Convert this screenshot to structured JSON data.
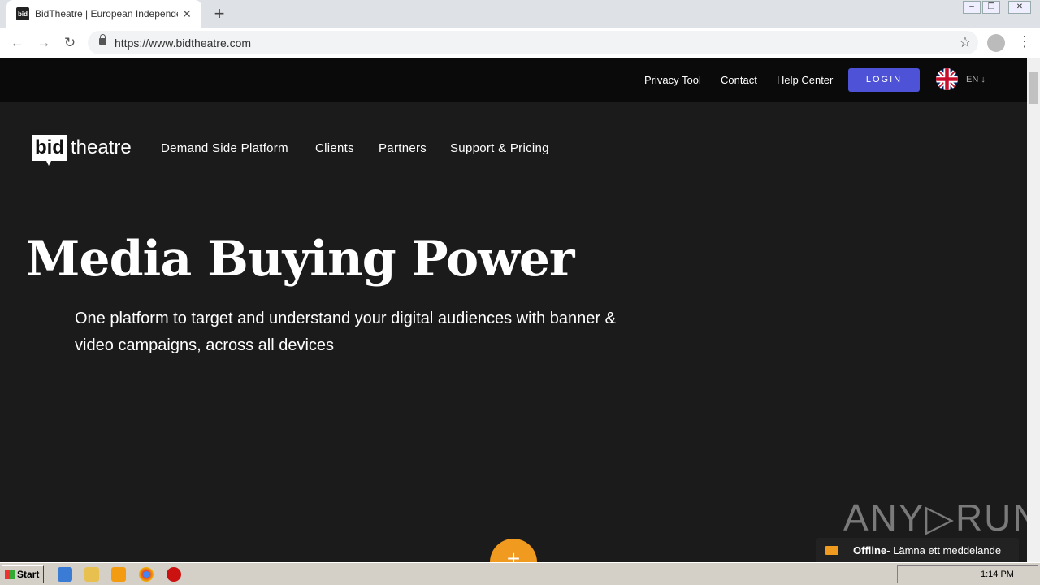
{
  "browser": {
    "tab_title": "BidTheatre | European Independent",
    "favicon_text": "bid",
    "url": "https://www.bidtheatre.com"
  },
  "topbar": {
    "links": [
      "Privacy Tool",
      "Contact",
      "Help Center"
    ],
    "login_label": "LOGIN",
    "language": "EN ↓"
  },
  "logo": {
    "bid": "bid",
    "theatre": "theatre"
  },
  "nav": [
    "Demand Side Platform",
    "Clients",
    "Partners",
    "Support & Pricing"
  ],
  "hero": {
    "title": "Media Buying Power",
    "subtitle": "One platform to target and understand your digital audiences with banner & video campaigns, across all devices"
  },
  "chat": {
    "status": "Offline",
    "message": " - Lämna ett meddelande"
  },
  "watermark": "ANY▷RUN",
  "taskbar": {
    "start_label": "Start",
    "clock": "1:14 PM"
  },
  "colors": {
    "login_button": "#4d52d6",
    "chat_button": "#f09a1f"
  }
}
